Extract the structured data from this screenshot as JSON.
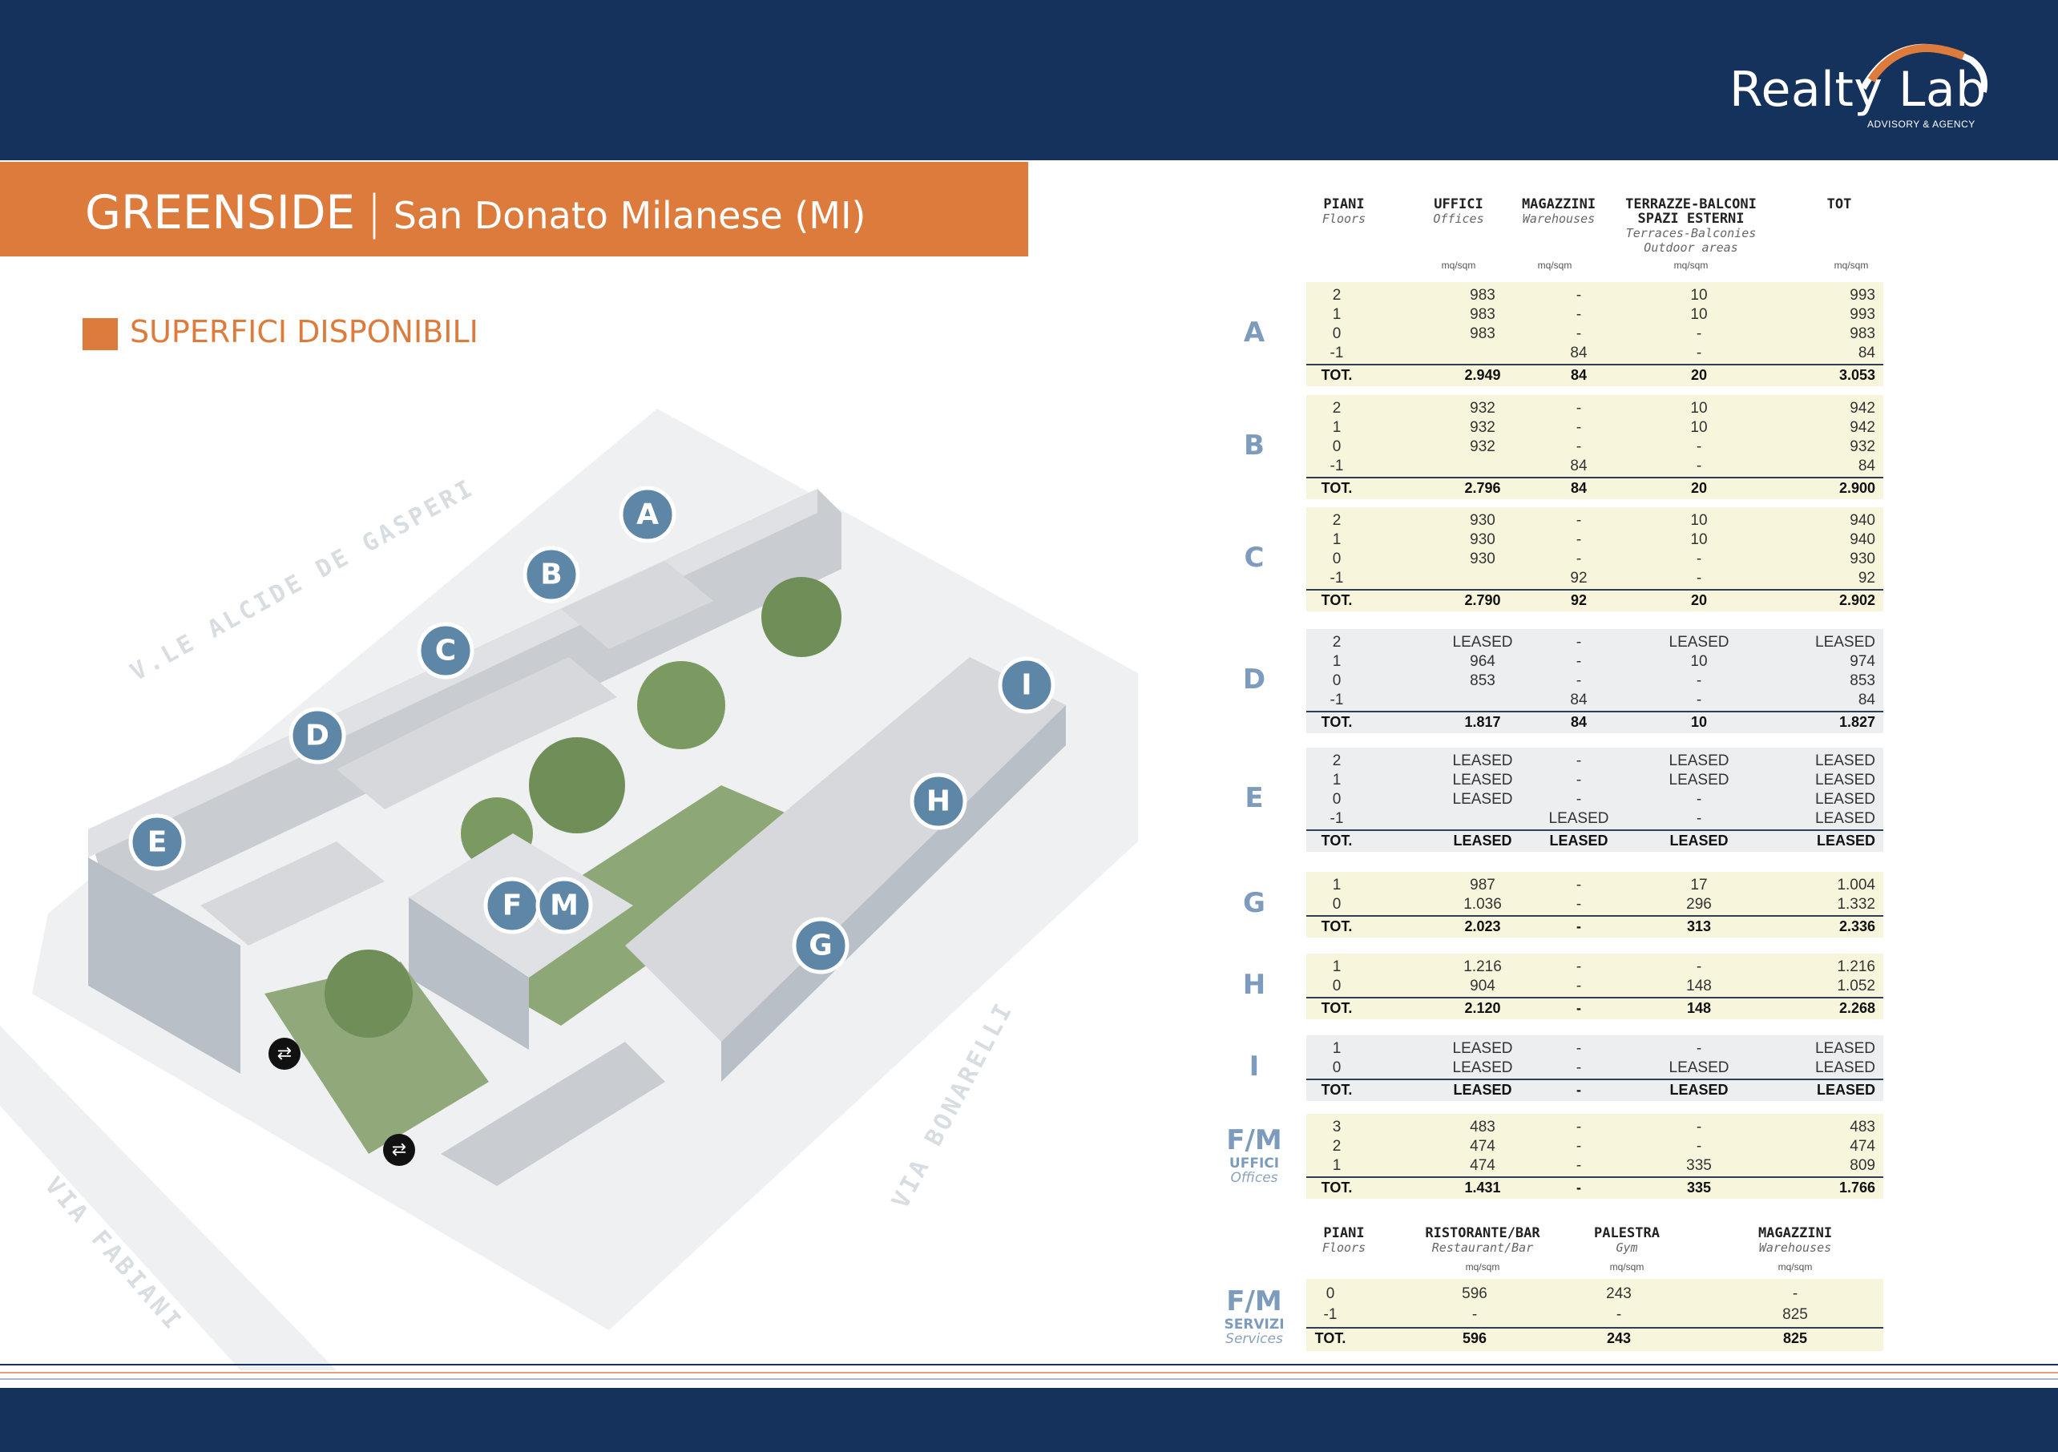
{
  "logo": {
    "text": "Realty Lab",
    "sub": "ADVISORY & AGENCY"
  },
  "title": {
    "main": "GREENSIDE",
    "sep": "|",
    "sub": "San Donato Milanese (MI)"
  },
  "section": {
    "title": "SUPERFICI DISPONIBILI"
  },
  "map": {
    "streets": [
      "V.LE ALCIDE DE GASPERI",
      "VIA FABIANI",
      "VIA BONARELLI"
    ],
    "markers": [
      "A",
      "B",
      "C",
      "D",
      "E",
      "F",
      "M",
      "G",
      "H",
      "I"
    ],
    "access_icon": "swap-arrows-icon"
  },
  "table": {
    "headers": {
      "piani": "PIANI",
      "piani_en": "Floors",
      "uffici": "UFFICI",
      "uffici_en": "Offices",
      "magazzini": "MAGAZZINI",
      "magazzini_en": "Warehouses",
      "terrazze": "TERRAZZE-BALCONI",
      "terrazze2": "SPAZI ESTERNI",
      "terrazze_en": "Terraces-Balconies",
      "terrazze_en2": "Outdoor areas",
      "tot": "TOT",
      "unit": "mq/sqm"
    },
    "blocks": [
      {
        "label": "A",
        "rows": [
          [
            "2",
            "983",
            "-",
            "10",
            "993"
          ],
          [
            "1",
            "983",
            "-",
            "10",
            "993"
          ],
          [
            "0",
            "983",
            "-",
            "-",
            "983"
          ],
          [
            "-1",
            "",
            "84",
            "-",
            "84"
          ]
        ],
        "total": [
          "TOT.",
          "2.949",
          "84",
          "20",
          "3.053"
        ]
      },
      {
        "label": "B",
        "rows": [
          [
            "2",
            "932",
            "-",
            "10",
            "942"
          ],
          [
            "1",
            "932",
            "-",
            "10",
            "942"
          ],
          [
            "0",
            "932",
            "-",
            "-",
            "932"
          ],
          [
            "-1",
            "",
            "84",
            "-",
            "84"
          ]
        ],
        "total": [
          "TOT.",
          "2.796",
          "84",
          "20",
          "2.900"
        ]
      },
      {
        "label": "C",
        "rows": [
          [
            "2",
            "930",
            "-",
            "10",
            "940"
          ],
          [
            "1",
            "930",
            "-",
            "10",
            "940"
          ],
          [
            "0",
            "930",
            "-",
            "-",
            "930"
          ],
          [
            "-1",
            "",
            "92",
            "-",
            "92"
          ]
        ],
        "total": [
          "TOT.",
          "2.790",
          "92",
          "20",
          "2.902"
        ]
      },
      {
        "label": "D",
        "rows": [
          [
            "2",
            "LEASED",
            "-",
            "LEASED",
            "LEASED"
          ],
          [
            "1",
            "964",
            "-",
            "10",
            "974"
          ],
          [
            "0",
            "853",
            "-",
            "-",
            "853"
          ],
          [
            "-1",
            "",
            "84",
            "-",
            "84"
          ]
        ],
        "total": [
          "TOT.",
          "1.817",
          "84",
          "10",
          "1.827"
        ]
      },
      {
        "label": "E",
        "rows": [
          [
            "2",
            "LEASED",
            "-",
            "LEASED",
            "LEASED"
          ],
          [
            "1",
            "LEASED",
            "-",
            "LEASED",
            "LEASED"
          ],
          [
            "0",
            "LEASED",
            "-",
            "-",
            "LEASED"
          ],
          [
            "-1",
            "",
            "LEASED",
            "-",
            "LEASED"
          ]
        ],
        "total": [
          "TOT.",
          "LEASED",
          "LEASED",
          "LEASED",
          "LEASED"
        ]
      },
      {
        "label": "G",
        "rows": [
          [
            "1",
            "987",
            "-",
            "17",
            "1.004"
          ],
          [
            "0",
            "1.036",
            "-",
            "296",
            "1.332"
          ]
        ],
        "total": [
          "TOT.",
          "2.023",
          "-",
          "313",
          "2.336"
        ]
      },
      {
        "label": "H",
        "rows": [
          [
            "1",
            "1.216",
            "-",
            "-",
            "1.216"
          ],
          [
            "0",
            "904",
            "-",
            "148",
            "1.052"
          ]
        ],
        "total": [
          "TOT.",
          "2.120",
          "-",
          "148",
          "2.268"
        ]
      },
      {
        "label": "I",
        "rows": [
          [
            "1",
            "LEASED",
            "-",
            "-",
            "LEASED"
          ],
          [
            "0",
            "LEASED",
            "-",
            "LEASED",
            "LEASED"
          ]
        ],
        "total": [
          "TOT.",
          "LEASED",
          "-",
          "LEASED",
          "LEASED"
        ]
      },
      {
        "label": "F/M",
        "label_sub": "UFFICI",
        "label_en": "Offices",
        "rows": [
          [
            "3",
            "483",
            "-",
            "-",
            "483"
          ],
          [
            "2",
            "474",
            "-",
            "-",
            "474"
          ],
          [
            "1",
            "474",
            "-",
            "335",
            "809"
          ]
        ],
        "total": [
          "TOT.",
          "1.431",
          "-",
          "335",
          "1.766"
        ]
      }
    ],
    "services": {
      "headers": {
        "piani": "PIANI",
        "piani_en": "Floors",
        "ristorante": "RISTORANTE/BAR",
        "ristorante_en": "Restaurant/Bar",
        "palestra": "PALESTRA",
        "palestra_en": "Gym",
        "magazzini": "MAGAZZINI",
        "magazzini_en": "Warehouses",
        "unit": "mq/sqm"
      },
      "label": "F/M",
      "label_sub": "SERVIZI",
      "label_en": "Services",
      "rows": [
        [
          "0",
          "596",
          "243",
          "-"
        ],
        [
          "-1",
          "-",
          "-",
          "825"
        ]
      ],
      "total": [
        "TOT.",
        "596",
        "243",
        "825"
      ]
    }
  },
  "colors": {
    "navy": "#15325c",
    "orange": "#dd7b3c",
    "row_bg": "#f7f6dc",
    "row_bg_alt": "#edeef0",
    "label_blue": "#7d9cbd"
  }
}
